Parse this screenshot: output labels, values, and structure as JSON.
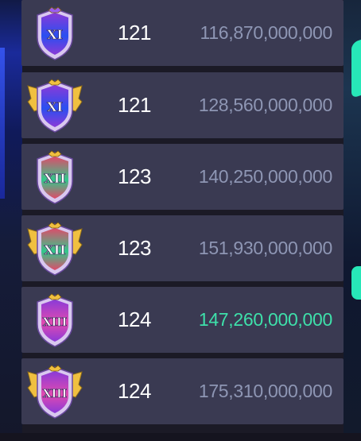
{
  "rows": [
    {
      "badge": {
        "numeral": "XI",
        "style": "shield",
        "colors": [
          "#8a3ad8",
          "#2a4ff0",
          "#9b5cf0"
        ]
      },
      "level": "121",
      "amount": "116,870,000,000",
      "highlight": false
    },
    {
      "badge": {
        "numeral": "XI",
        "style": "winged",
        "colors": [
          "#8a3ad8",
          "#2a4ff0",
          "#f0c040"
        ]
      },
      "level": "121",
      "amount": "128,560,000,000",
      "highlight": false
    },
    {
      "badge": {
        "numeral": "XII",
        "style": "shield",
        "colors": [
          "#e04a6a",
          "#31c98c",
          "#f0c040"
        ]
      },
      "level": "123",
      "amount": "140,250,000,000",
      "highlight": false
    },
    {
      "badge": {
        "numeral": "XII",
        "style": "winged",
        "colors": [
          "#e04a6a",
          "#31c98c",
          "#f0c040"
        ]
      },
      "level": "123",
      "amount": "151,930,000,000",
      "highlight": false
    },
    {
      "badge": {
        "numeral": "XIII",
        "style": "shield",
        "colors": [
          "#8a3ad8",
          "#e04ab0",
          "#f0c040"
        ]
      },
      "level": "124",
      "amount": "147,260,000,000",
      "highlight": true
    },
    {
      "badge": {
        "numeral": "XIII",
        "style": "winged",
        "colors": [
          "#8a3ad8",
          "#e04ab0",
          "#f0c040"
        ]
      },
      "level": "124",
      "amount": "175,310,000,000",
      "highlight": false
    }
  ],
  "colors": {
    "row_bg": "#3a3a52",
    "amount_text": "#8e96b4",
    "amount_highlight": "#3ee0aa",
    "level_text": "#ffffff"
  }
}
